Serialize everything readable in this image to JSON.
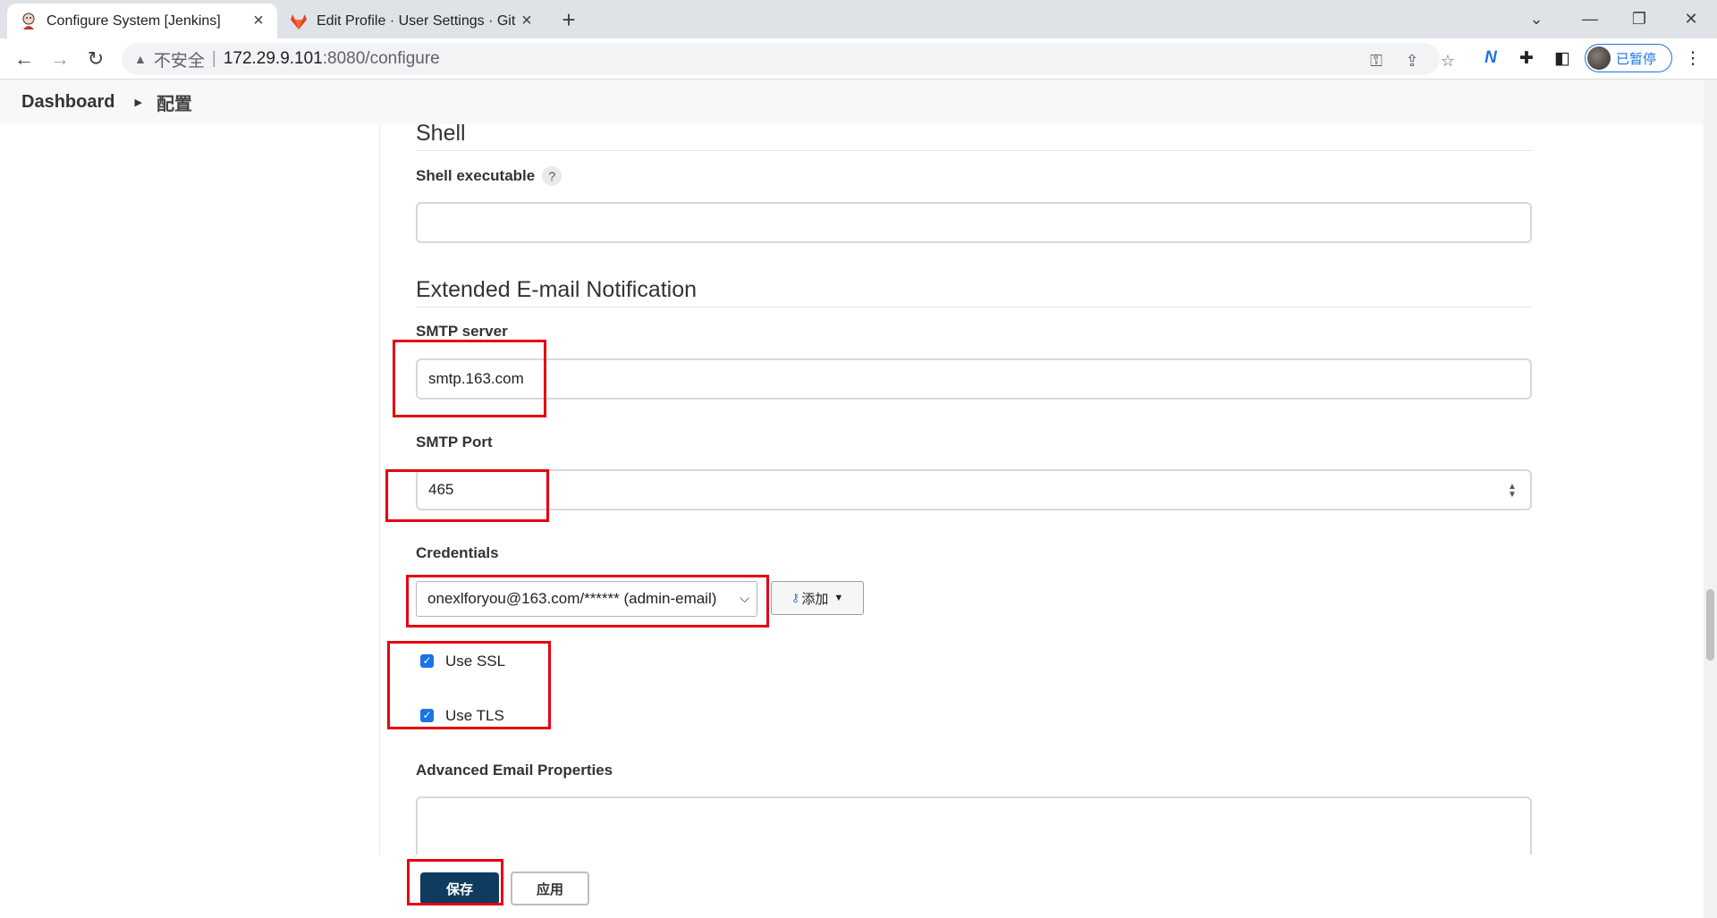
{
  "browser": {
    "tabs": [
      {
        "title": "Configure System [Jenkins]",
        "active": true
      },
      {
        "title": "Edit Profile · User Settings · Git",
        "active": false
      }
    ],
    "address": {
      "security_label": "不安全",
      "host": "172.29.9.101",
      "path": ":8080/configure"
    },
    "profile_label": "已暂停"
  },
  "breadcrumb": {
    "root": "Dashboard",
    "current": "配置"
  },
  "shell": {
    "title": "Shell",
    "executable_label": "Shell executable",
    "help": "?",
    "executable_value": ""
  },
  "email": {
    "title": "Extended E-mail Notification",
    "smtp_server_label": "SMTP server",
    "smtp_server_value": "smtp.163.com",
    "smtp_port_label": "SMTP Port",
    "smtp_port_value": "465",
    "credentials_label": "Credentials",
    "credentials_selected": "onexlforyou@163.com/****** (admin-email)",
    "add_button_label": "添加",
    "use_ssl_label": "Use SSL",
    "use_ssl_checked": true,
    "use_tls_label": "Use TLS",
    "use_tls_checked": true,
    "advanced_props_label": "Advanced Email Properties",
    "advanced_props_value": ""
  },
  "actions": {
    "save_label": "保存",
    "apply_label": "应用"
  },
  "colors": {
    "highlight": "#e60012",
    "save_button": "#0f3b5f",
    "checkbox": "#1a73e8"
  }
}
